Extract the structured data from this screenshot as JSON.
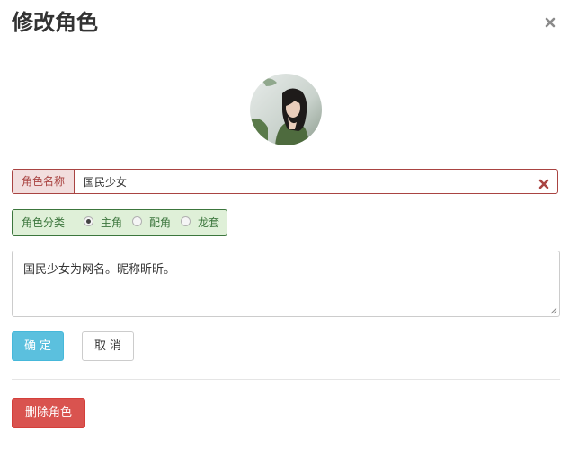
{
  "dialog": {
    "title": "修改角色",
    "close_icon": "close-icon"
  },
  "avatar": {
    "icon": "avatar-photo"
  },
  "name_field": {
    "label": "角色名称",
    "value": "国民少女",
    "clear_icon": "clear-x-icon",
    "state_color": "#a94442"
  },
  "category": {
    "label": "角色分类",
    "state_color": "#3c763d",
    "options": [
      {
        "label": "主角",
        "checked": true
      },
      {
        "label": "配角",
        "checked": false
      },
      {
        "label": "龙套",
        "checked": false
      }
    ]
  },
  "description": {
    "value": "国民少女为网名。昵称昕昕。"
  },
  "actions": {
    "ok_label": "确定",
    "cancel_label": "取消",
    "ok_color": "#5bc0de"
  },
  "danger": {
    "delete_label": "删除角色",
    "color": "#d9534f"
  }
}
